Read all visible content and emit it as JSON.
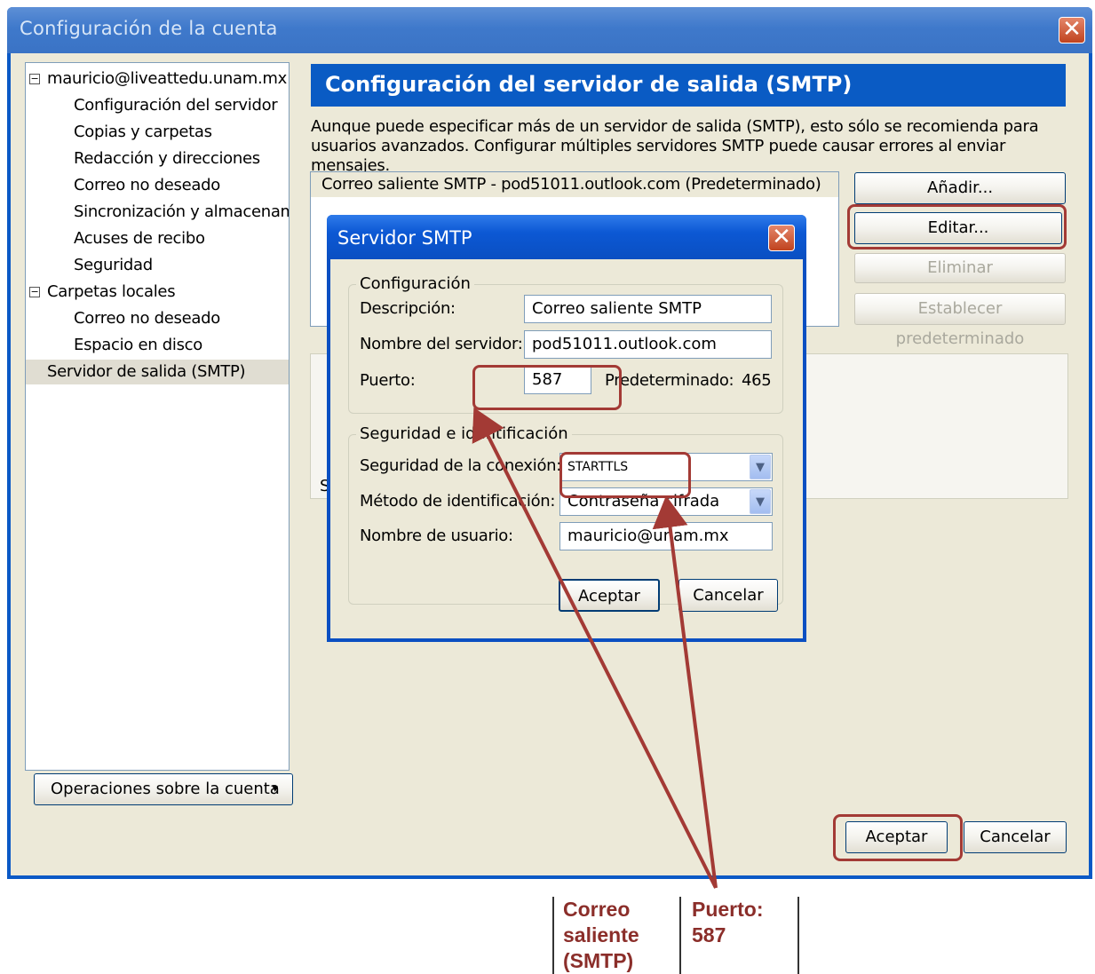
{
  "main_window": {
    "title": "Configuración de la cuenta",
    "close_glyph": "✕"
  },
  "tree": {
    "toggle_glyph": "−",
    "items": [
      {
        "label": "mauricio@liveattedu.unam.mx",
        "level": 0,
        "toggle": true
      },
      {
        "label": "Configuración del servidor",
        "level": 1
      },
      {
        "label": "Copias y carpetas",
        "level": 1
      },
      {
        "label": "Redacción y direcciones",
        "level": 1
      },
      {
        "label": "Correo no deseado",
        "level": 1
      },
      {
        "label": "Sincronización y almacenam...",
        "level": 1
      },
      {
        "label": "Acuses de recibo",
        "level": 1
      },
      {
        "label": "Seguridad",
        "level": 1
      },
      {
        "label": "Carpetas locales",
        "level": 0,
        "toggle": true
      },
      {
        "label": "Correo no deseado",
        "level": 1
      },
      {
        "label": "Espacio en disco",
        "level": 1
      },
      {
        "label": "Servidor de salida (SMTP)",
        "level": 0,
        "selected": true
      }
    ]
  },
  "account_actions": {
    "label": "Operaciones sobre la cuenta",
    "arrow": "▾"
  },
  "smtp_panel": {
    "header": "Configuración del servidor de salida (SMTP)",
    "description": "Aunque puede especificar más de un servidor de salida (SMTP), esto sólo se recomienda para usuarios avanzados. Configurar múltiples servidores SMTP puede causar errores al enviar mensajes.",
    "server_item": "Correo saliente SMTP - pod51011.outlook.com (Predeterminado)",
    "add_button": "Añadir...",
    "edit_button": "Editar...",
    "delete_button": "Eliminar",
    "set_default_button": "Establecer predeterminado",
    "details_fragment": "S"
  },
  "main_buttons": {
    "ok": "Aceptar",
    "cancel": "Cancelar"
  },
  "dialog": {
    "title": "Servidor SMTP",
    "close_glyph": "✕",
    "config_group": "Configuración",
    "description_label": "Descripción:",
    "description_value": "Correo saliente SMTP",
    "server_label": "Nombre del servidor:",
    "server_value": "pod51011.outlook.com",
    "port_label": "Puerto:",
    "port_value": "587",
    "default_label": "Predeterminado:",
    "default_value": "465",
    "security_group": "Seguridad e identificación",
    "conn_security_label": "Seguridad de la conexión:",
    "conn_security_value": "STARTTLS",
    "auth_method_label": "Método de identificación:",
    "auth_method_value": "Contraseña cifrada",
    "username_label": "Nombre de usuario:",
    "username_value": "mauricio@unam.mx",
    "select_arrow": "▼",
    "ok_button": "Aceptar",
    "cancel_button": "Cancelar"
  },
  "callout": {
    "left_text": [
      "Correo",
      "saliente",
      "(SMTP)"
    ],
    "right_text": [
      "Puerto:",
      "587"
    ]
  },
  "colors": {
    "annotation": "#a33a35",
    "title_bar": "#0a59c6",
    "header": "#0a5bc4"
  }
}
